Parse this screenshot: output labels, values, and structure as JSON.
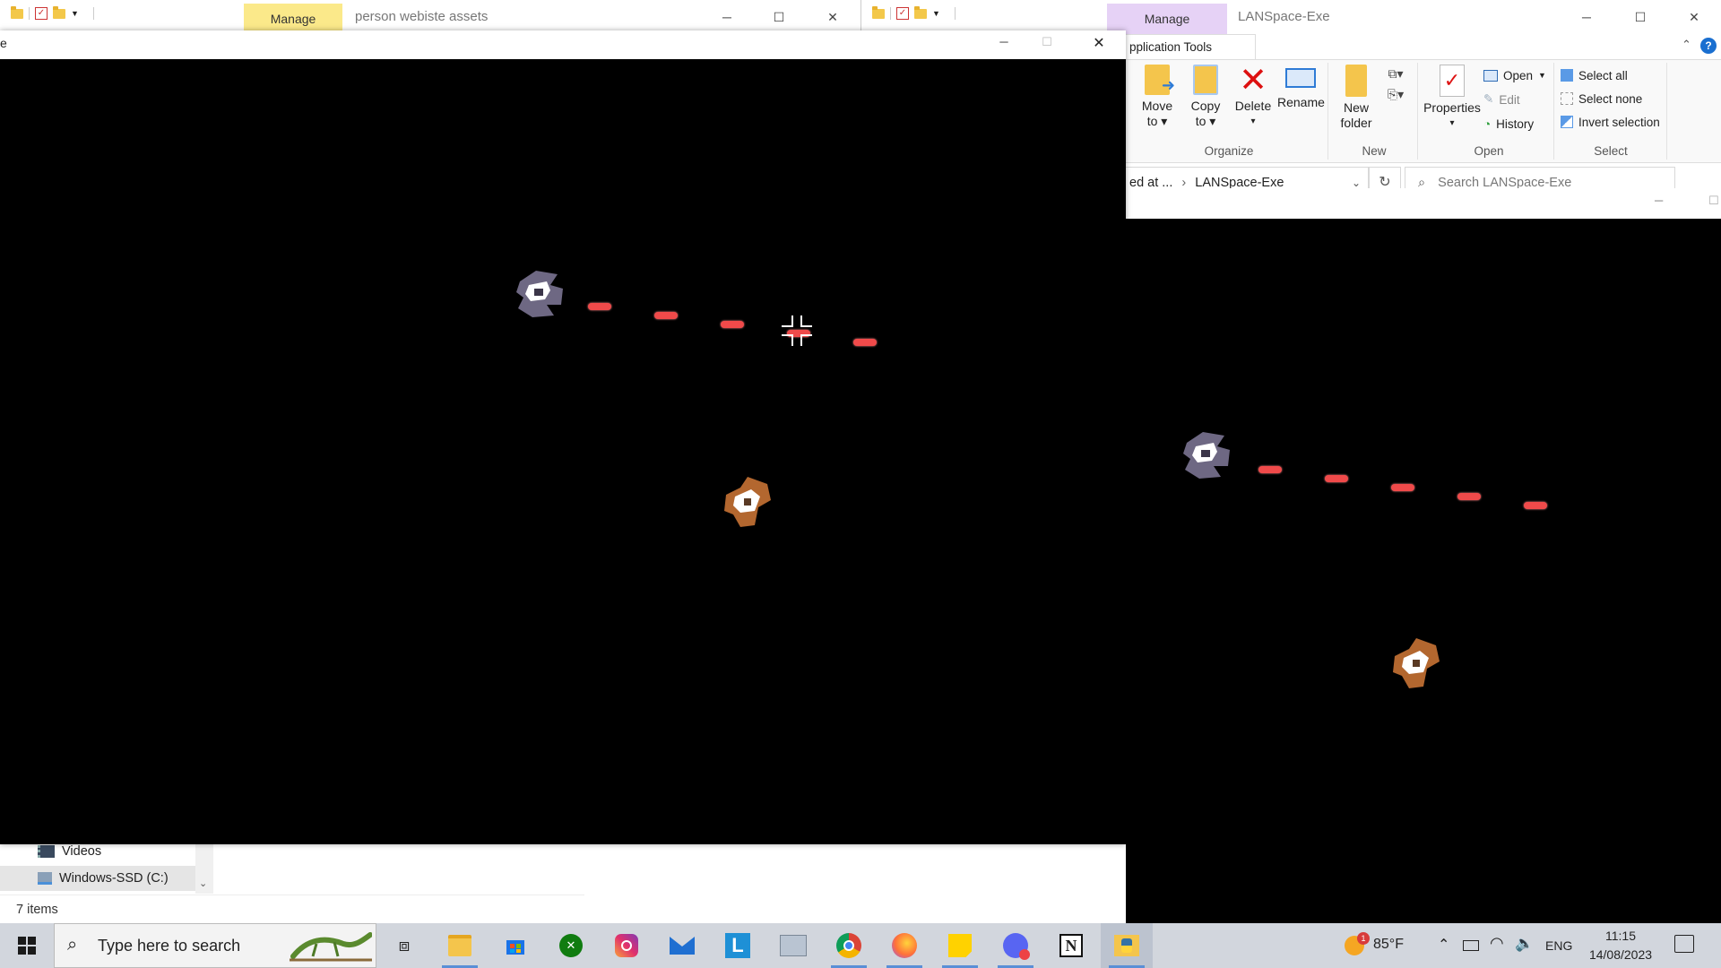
{
  "explorer_left": {
    "manage_tab": "Manage",
    "title": "person webiste assets",
    "nav_items": [
      {
        "label": "Videos",
        "icon": "videos-icon"
      },
      {
        "label": "Windows-SSD (C:)",
        "icon": "drive-icon"
      }
    ],
    "status": "7 items"
  },
  "explorer_right": {
    "manage_tab": "Manage",
    "title": "LANSpace-Exe",
    "context_tab": "pplication Tools",
    "ribbon": {
      "move_to": "Move",
      "move_to_2": "to",
      "copy_to": "Copy",
      "copy_to_2": "to",
      "delete": "Delete",
      "rename": "Rename",
      "new_folder": "New",
      "new_folder_2": "folder",
      "properties": "Properties",
      "open": "Open",
      "edit": "Edit",
      "history": "History",
      "select_all": "Select all",
      "select_none": "Select none",
      "invert_selection": "Invert selection",
      "groups": {
        "organize": "Organize",
        "new": "New",
        "open": "Open",
        "select": "Select"
      }
    },
    "address": {
      "prefix": "ed at ...",
      "current": "LANSpace-Exe"
    },
    "search_placeholder": "Search LANSpace-Exe"
  },
  "game_window_main": {
    "title_fragment": "e"
  },
  "colors": {
    "manage_left": "#fbe98a",
    "manage_right": "#e6d2f6",
    "bullet": "#f04a4a",
    "taskbar": "#d2d6dd"
  },
  "taskbar": {
    "search_placeholder": "Type here to search",
    "weather": "85°F",
    "weather_badge": "1",
    "language": "ENG",
    "time": "11:15",
    "date": "14/08/2023",
    "pinned": [
      "task-view-icon",
      "file-explorer-icon",
      "microsoft-store-icon",
      "xbox-icon",
      "instagram-icon",
      "mail-icon",
      "l-app-icon",
      "network-tool-icon",
      "chrome-icon",
      "firefox-icon",
      "sticky-notes-icon",
      "discord-icon",
      "notion-icon",
      "python-game-icon"
    ]
  }
}
